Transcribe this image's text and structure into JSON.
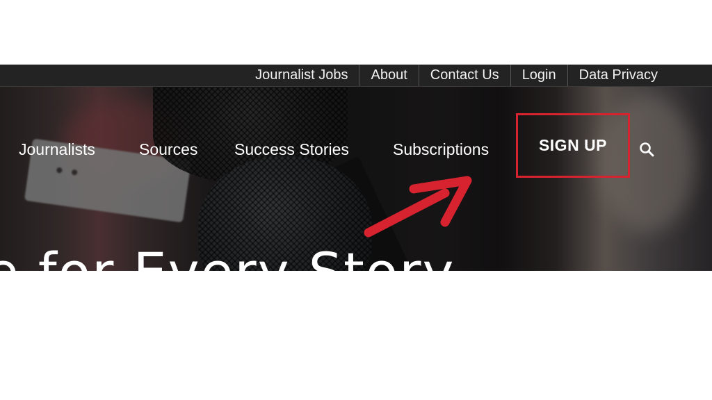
{
  "top_nav": {
    "items": [
      {
        "label": "Journalist Jobs"
      },
      {
        "label": "About"
      },
      {
        "label": "Contact Us"
      },
      {
        "label": "Login"
      },
      {
        "label": "Data Privacy"
      }
    ]
  },
  "main_nav": {
    "items": [
      {
        "label": "Journalists"
      },
      {
        "label": "Sources"
      },
      {
        "label": "Success Stories"
      },
      {
        "label": "Subscriptions"
      }
    ],
    "signup_label": "SIGN UP",
    "search_icon": "search-icon"
  },
  "hero": {
    "title_fragment": "e for Every Story"
  },
  "annotation": {
    "highlight_color": "#d7232f",
    "arrow_icon": "arrow-up-right-icon"
  }
}
